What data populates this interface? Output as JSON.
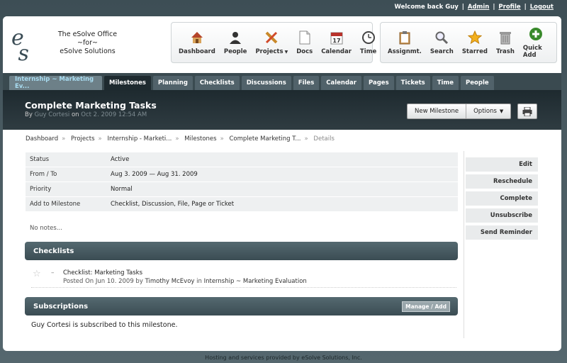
{
  "welcome": {
    "greeting": "Welcome back Guy",
    "links": [
      "Admin",
      "Profile",
      "Logout"
    ]
  },
  "org": {
    "line1": "The eSolve Office",
    "line2": "~for~",
    "line3": "eSolve Solutions"
  },
  "toolbar_main": [
    {
      "label": "Dashboard",
      "icon": "house-icon"
    },
    {
      "label": "People",
      "icon": "people-icon"
    },
    {
      "label": "Projects",
      "icon": "tools-icon"
    },
    {
      "label": "Docs",
      "icon": "document-icon"
    },
    {
      "label": "Calendar",
      "icon": "calendar-icon"
    },
    {
      "label": "Time",
      "icon": "clock-icon"
    }
  ],
  "toolbar_secondary": [
    {
      "label": "Assignmt.",
      "icon": "clipboard-icon"
    },
    {
      "label": "Search",
      "icon": "magnifier-icon"
    },
    {
      "label": "Starred",
      "icon": "star-icon"
    },
    {
      "label": "Trash",
      "icon": "trash-icon"
    },
    {
      "label": "Quick Add",
      "icon": "plus-icon"
    }
  ],
  "calendar_icon_day": "17",
  "tabs": {
    "project": "Internship ~ Marketing Ev...",
    "items": [
      "Milestones",
      "Planning",
      "Checklists",
      "Discussions",
      "Files",
      "Calendar",
      "Pages",
      "Tickets",
      "Time",
      "People"
    ]
  },
  "page": {
    "title": "Complete Marketing Tasks",
    "by": "By",
    "author": "Guy Cortesi",
    "on": "on",
    "date": "Oct 2. 2009 12:54 AM"
  },
  "actions": {
    "new_milestone": "New Milestone",
    "options": "Options"
  },
  "breadcrumb": [
    "Dashboard",
    "Projects",
    "Internship - Marketi...",
    "Milestones",
    "Complete Marketing T...",
    "Details"
  ],
  "details": [
    {
      "label": "Status",
      "value": "Active"
    },
    {
      "label": "From / To",
      "value": "Aug 3. 2009 — Aug 31. 2009"
    },
    {
      "label": "Priority",
      "value": "Normal"
    },
    {
      "label": "Add to Milestone",
      "value": "Checklist, Discussion, File, Page or Ticket"
    }
  ],
  "notes": "No notes...",
  "sidebar": [
    "Edit",
    "Reschedule",
    "Complete",
    "Unsubscribe",
    "Send Reminder"
  ],
  "checklists": {
    "heading": "Checklists",
    "item": {
      "dash": "–",
      "title": "Checklist: Marketing Tasks",
      "posted_prefix": "Posted On Jun 10. 2009 by",
      "author": "Timothy McEvoy",
      "in": "in",
      "project": "Internship ~ Marketing Evaluation"
    }
  },
  "subscriptions": {
    "heading": "Subscriptions",
    "manage": "Manage / Add",
    "text": "Guy Cortesi is subscribed to this milestone."
  },
  "footer": "Hosting and services provided by eSolve Solutions, Inc.",
  "colors": {
    "background": "#4a5b62",
    "tab_active": "#1e2a2f",
    "panel_head": "#3b4c53",
    "project_tab_text": "#a9ddf2"
  }
}
